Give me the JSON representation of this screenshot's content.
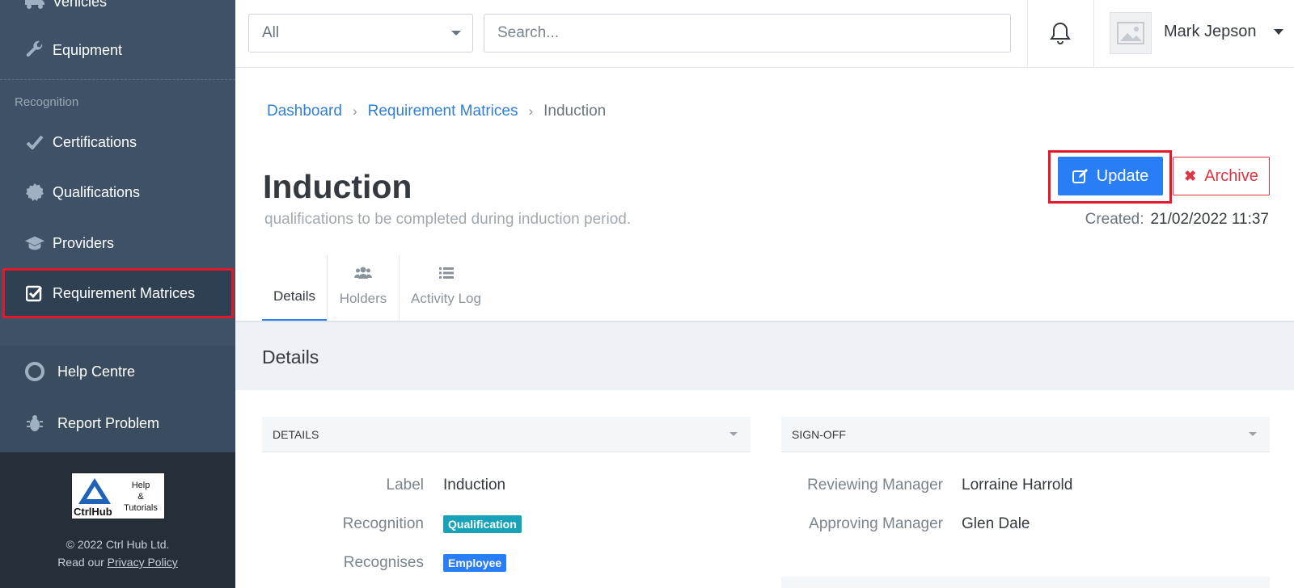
{
  "sidebar": {
    "items_top": [
      {
        "label": "Vehicles",
        "icon": "truck-icon"
      },
      {
        "label": "Equipment",
        "icon": "wrench-icon"
      }
    ],
    "section_label": "Recognition",
    "items": [
      {
        "label": "Certifications",
        "icon": "check-icon"
      },
      {
        "label": "Qualifications",
        "icon": "certificate-icon"
      },
      {
        "label": "Providers",
        "icon": "graduation-cap-icon"
      },
      {
        "label": "Requirement Matrices",
        "icon": "check-square-icon"
      }
    ],
    "bottom_items": [
      {
        "label": "Help Centre",
        "icon": "life-ring-icon"
      },
      {
        "label": "Report Problem",
        "icon": "bug-icon"
      }
    ],
    "logo": {
      "brand": "CtrlHub",
      "help_lines": [
        "Help",
        "&",
        "Tutorials"
      ]
    },
    "copyright": "© 2022 Ctrl Hub Ltd.",
    "policy_prefix": "Read our",
    "policy_link": "Privacy Policy"
  },
  "topbar": {
    "filter_value": "All",
    "search_placeholder": "Search...",
    "user_name": "Mark Jepson"
  },
  "breadcrumb": [
    "Dashboard",
    "Requirement Matrices",
    "Induction"
  ],
  "page": {
    "title": "Induction",
    "subtitle": "qualifications to be completed during induction period.",
    "update_label": "Update",
    "archive_label": "Archive",
    "created_key": "Created:",
    "created_value": "21/02/2022 11:37"
  },
  "tabs": [
    {
      "label": "Details",
      "icon": "info-icon"
    },
    {
      "label": "Holders",
      "icon": "users-icon"
    },
    {
      "label": "Activity Log",
      "icon": "list-icon"
    }
  ],
  "details_heading": "Details",
  "panels": {
    "details": {
      "heading": "DETAILS",
      "rows": [
        {
          "key": "Label",
          "value": "Induction"
        },
        {
          "key": "Recognition",
          "value": "Qualification"
        },
        {
          "key": "Recognises",
          "value": "Employee"
        }
      ]
    },
    "signoff": {
      "heading": "SIGN-OFF",
      "rows": [
        {
          "key": "Reviewing Manager",
          "value": "Lorraine Harrold"
        },
        {
          "key": "Approving Manager",
          "value": "Glen Dale"
        }
      ]
    }
  },
  "colors": {
    "accent": "#2a7ef5",
    "danger": "#dc3545",
    "sidebar": "#3e5166",
    "highlight": "#e3192b"
  }
}
